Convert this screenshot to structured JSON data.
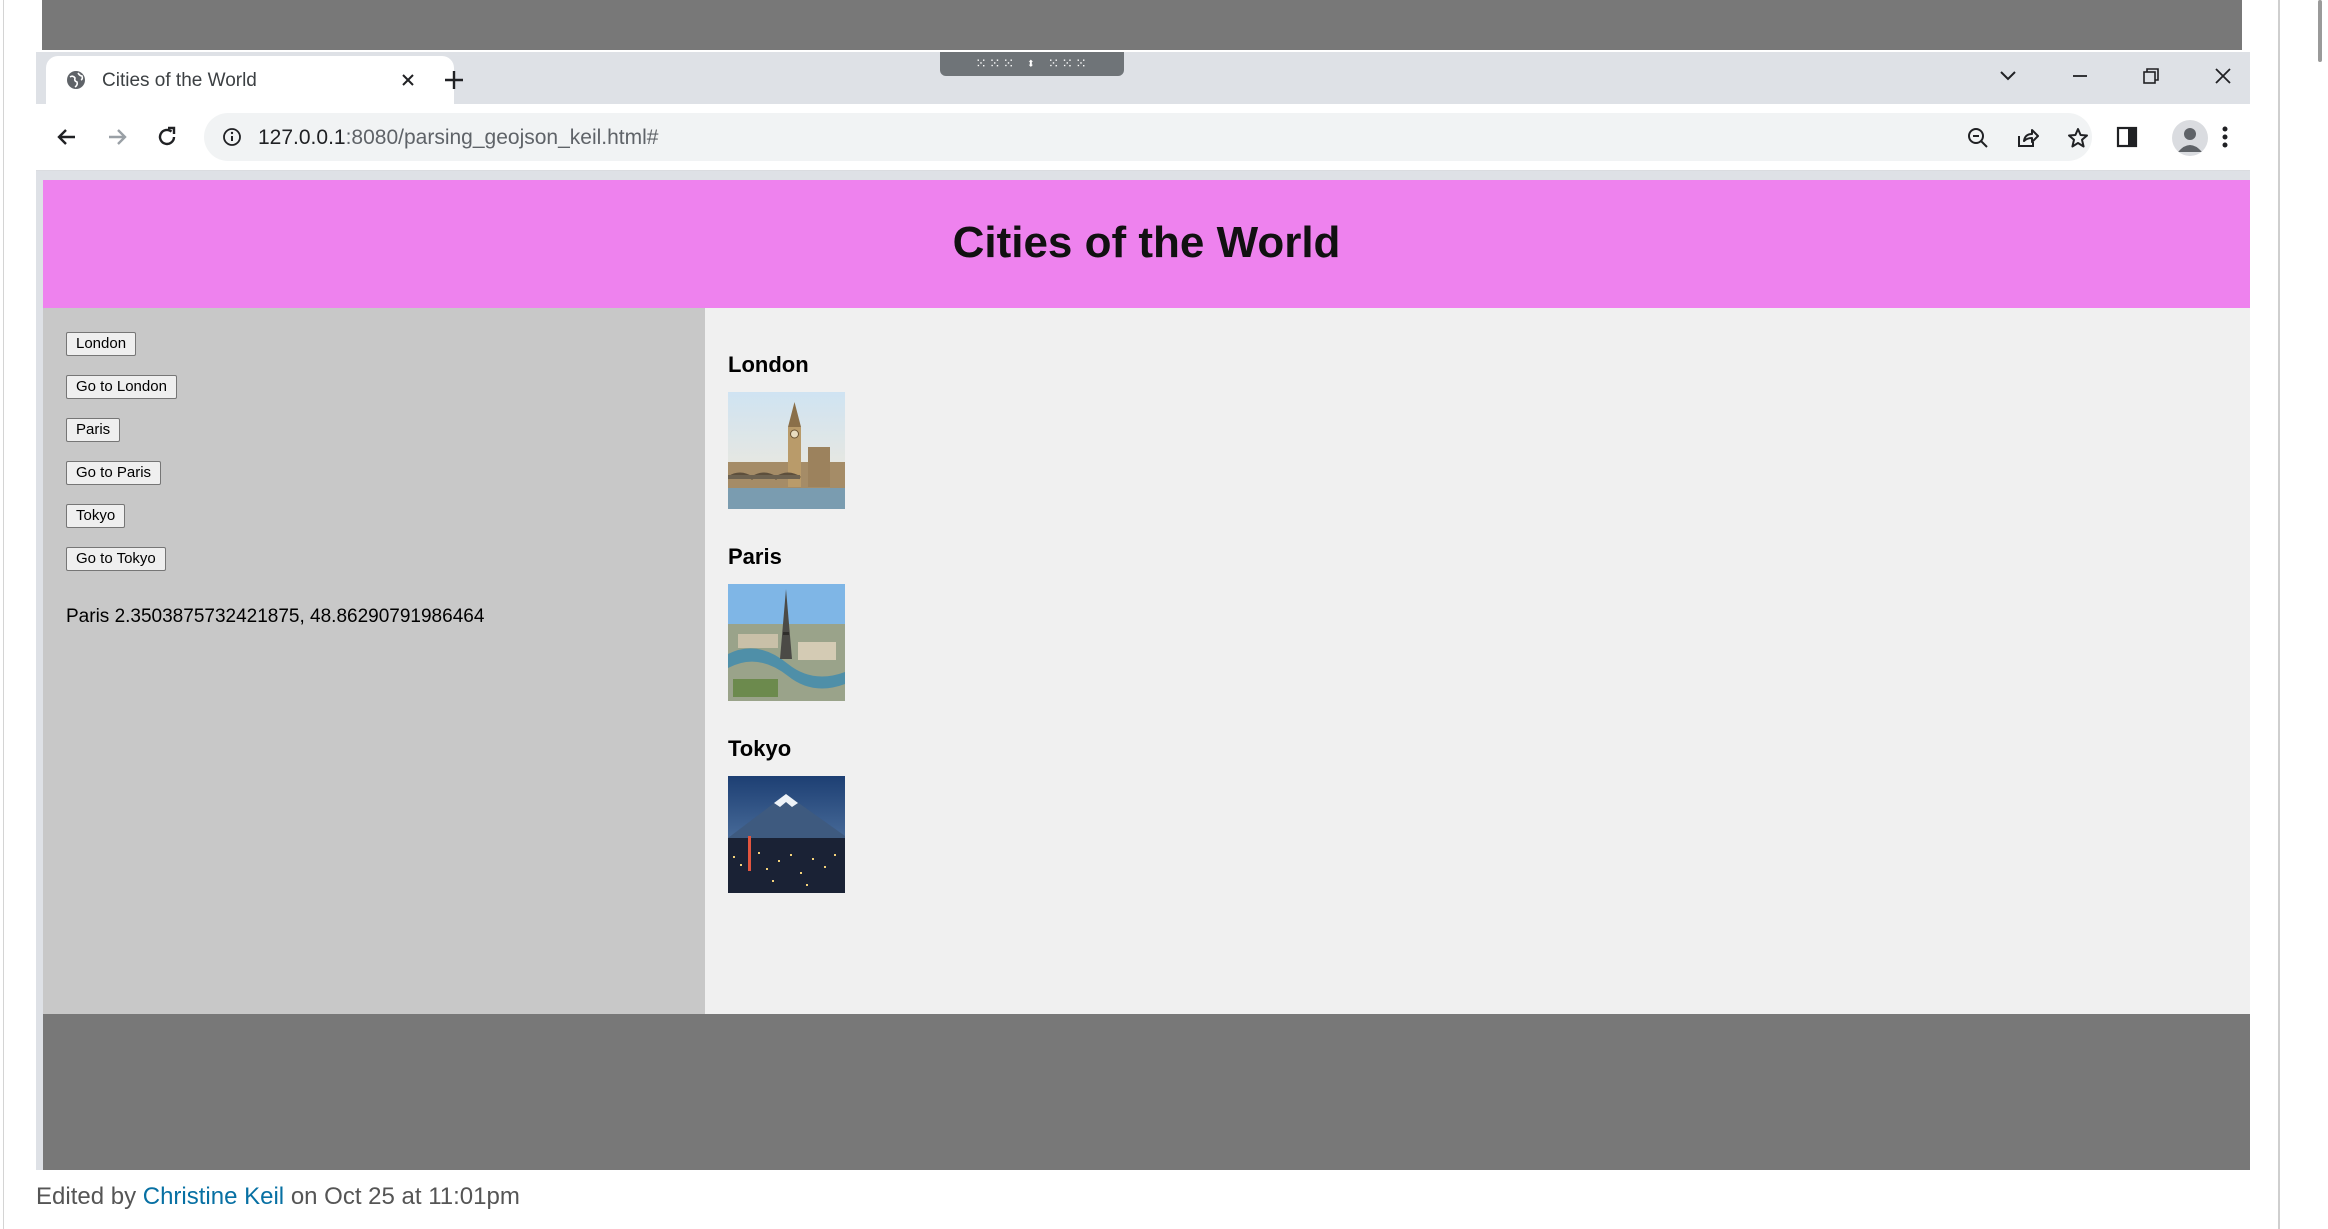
{
  "browser": {
    "tab_title": "Cities of the World",
    "address_host": "127.0.0.1",
    "address_rest": ":8080/parsing_geojson_keil.html#"
  },
  "page": {
    "title": "Cities of the World",
    "sidebar_buttons": [
      "London",
      "Go to London",
      "Paris",
      "Go to Paris",
      "Tokyo",
      "Go to Tokyo"
    ],
    "coordinate_text": "Paris 2.3503875732421875, 48.86290791986464",
    "cities": [
      {
        "name": "London",
        "image": "big-ben-westminster-photo"
      },
      {
        "name": "Paris",
        "image": "eiffel-tower-seine-photo"
      },
      {
        "name": "Tokyo",
        "image": "mount-fuji-tokyo-night-photo"
      }
    ]
  },
  "footer": {
    "edited_prefix": "Edited by",
    "editor_name": "Christine Keil",
    "edited_suffix": "on Oct 25 at 11:01pm"
  },
  "colors": {
    "header_bg": "#ee82ee",
    "sidebar_bg": "#c8c8c8",
    "main_bg": "#f0f0f0",
    "footer_bg": "#787878",
    "link": "#0770a3"
  },
  "icons": {
    "tab_favicon": "globe-icon",
    "tab_close": "close-icon",
    "new_tab": "plus-icon",
    "back": "back-arrow-icon",
    "forward": "forward-arrow-icon",
    "reload": "reload-icon",
    "site_info": "info-icon",
    "zoom": "zoom-out-icon",
    "share": "share-icon",
    "bookmark": "star-icon",
    "side_panel": "side-panel-icon",
    "profile": "profile-avatar-icon",
    "menu": "kebab-menu-icon"
  }
}
